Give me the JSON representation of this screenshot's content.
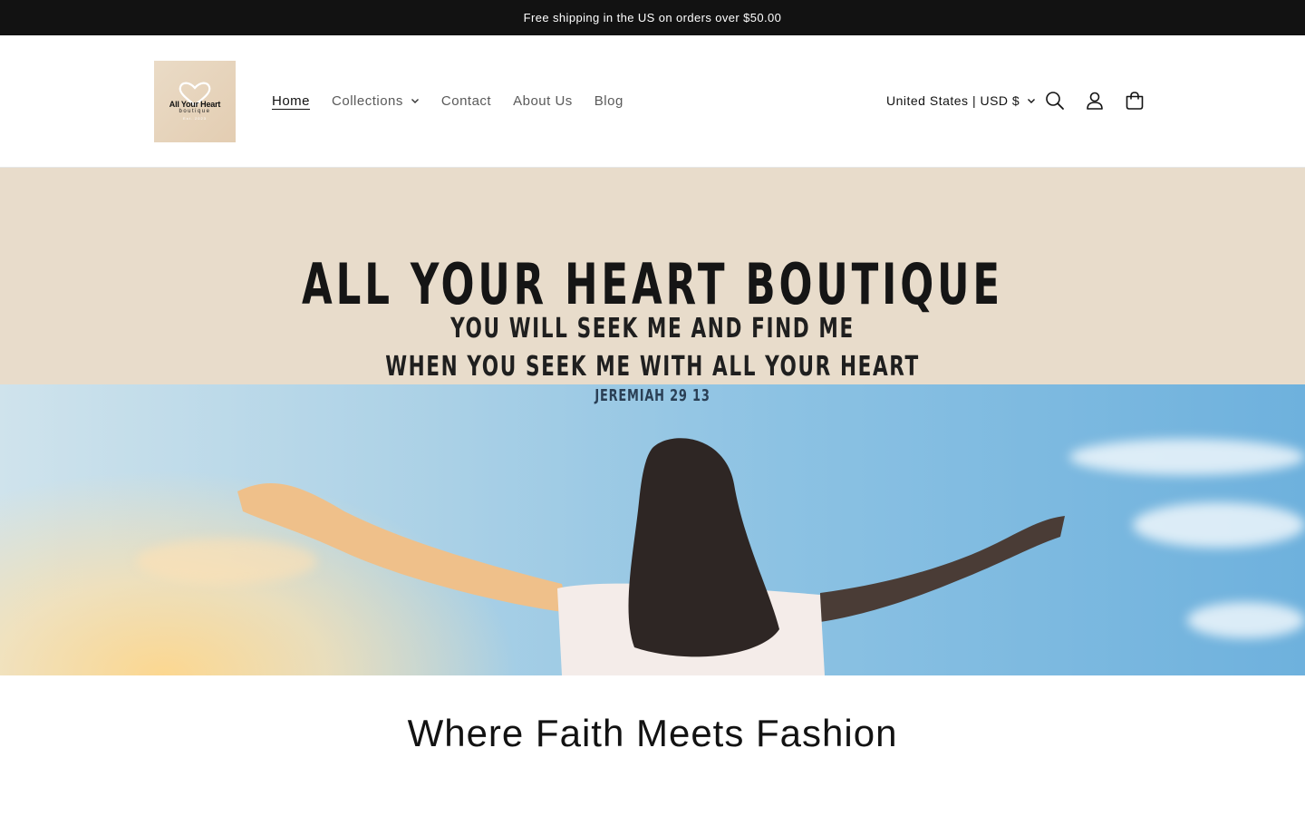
{
  "announcement": {
    "text": "Free shipping in the US on orders over $50.00"
  },
  "header": {
    "logo": {
      "title": "All Your Heart",
      "subtitle": "boutique",
      "est": "Est. 2023"
    },
    "nav": [
      {
        "label": "Home",
        "active": true
      },
      {
        "label": "Collections",
        "has_dropdown": true
      },
      {
        "label": "Contact"
      },
      {
        "label": "About Us"
      },
      {
        "label": "Blog"
      }
    ],
    "country_selector": "United States | USD $",
    "icons": [
      "search-icon",
      "account-icon",
      "cart-icon"
    ]
  },
  "hero": {
    "title": "ALL YOUR HEART BOUTIQUE",
    "line1": "YOU WILL SEEK ME AND FIND ME",
    "line2": "WHEN YOU SEEK ME WITH ALL YOUR HEART",
    "reference": "JEREMIAH 29 13"
  },
  "section": {
    "heading": "Where Faith Meets Fashion"
  },
  "colors": {
    "announcement_bg": "#121212",
    "hero_top_bg": "#e8dccb",
    "logo_bg": "#e3cdb2"
  }
}
